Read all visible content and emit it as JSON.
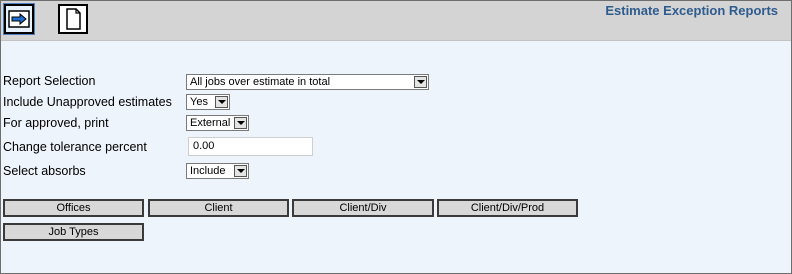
{
  "toolbar": {
    "run_icon": "arrow-right-icon",
    "new_icon": "document-icon",
    "title": "Estimate Exception Reports"
  },
  "form": {
    "report_selection": {
      "label": "Report Selection",
      "value": "All jobs over estimate in total"
    },
    "include_unapproved": {
      "label": "Include Unapproved estimates",
      "value": "Yes"
    },
    "for_approved_print": {
      "label": "For approved, print",
      "value": "External"
    },
    "change_tolerance": {
      "label": "Change tolerance percent",
      "value": "0.00"
    },
    "select_absorbs": {
      "label": "Select absorbs",
      "value": "Include"
    }
  },
  "buttons": {
    "offices": "Offices",
    "client": "Client",
    "client_div": "Client/Div",
    "client_div_prod": "Client/Div/Prod",
    "job_types": "Job Types"
  },
  "colors": {
    "title": "#2e5c8f",
    "page_background": "#eef4fb",
    "toolbar_background": "#d4d4d4"
  }
}
